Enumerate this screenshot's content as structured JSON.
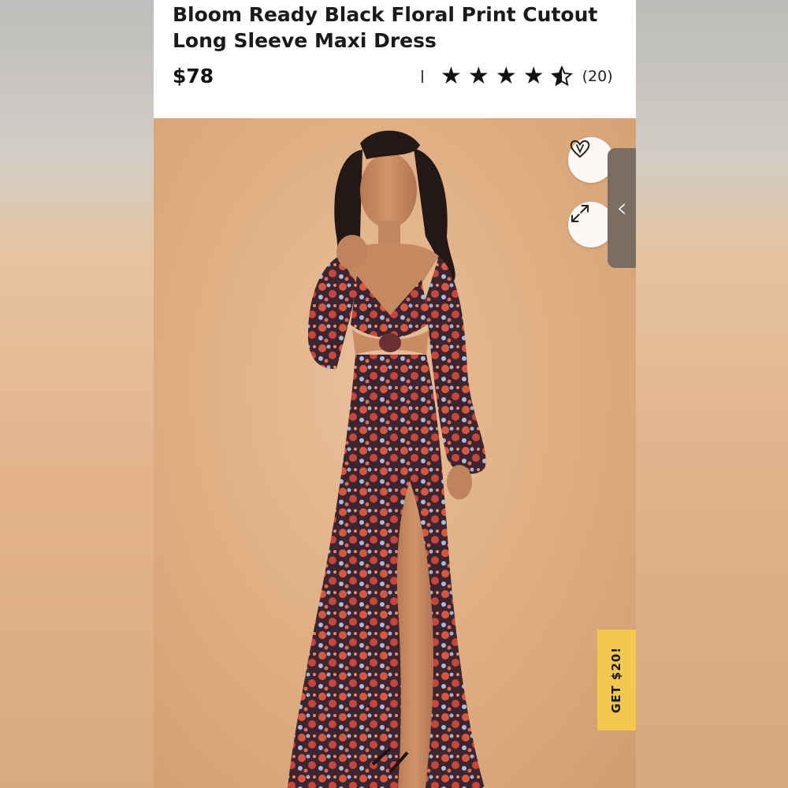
{
  "product": {
    "title": "Bloom Ready Black Floral Print Cutout Long Sleeve Maxi Dress",
    "price": "$78",
    "rating": {
      "value": 4.5,
      "max": 5,
      "count_label": "(20)"
    }
  },
  "controls": {
    "wishlist_icon": "heart-icon",
    "expand_icon": "expand-icon",
    "panel_tab_icon": "chevron-left-icon",
    "panel_tab_glyph": "‹"
  },
  "promo": {
    "label": "GET $20!",
    "color": "#f3c84e"
  },
  "colors": {
    "accent": "#f3c84e",
    "tab": "#7a6e63"
  }
}
